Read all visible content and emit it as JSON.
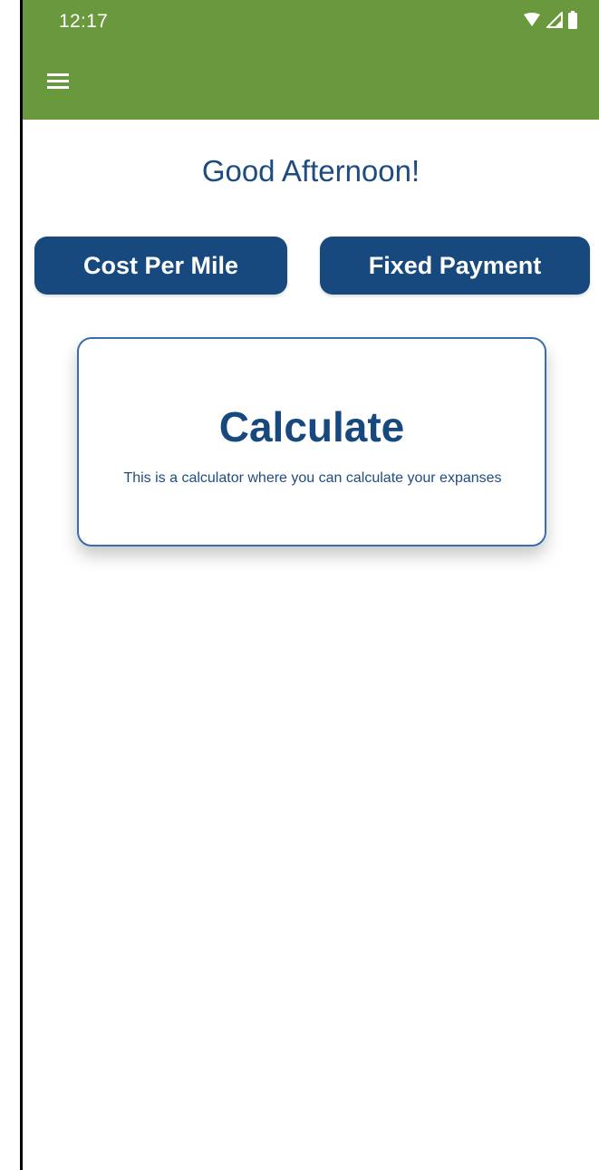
{
  "status_bar": {
    "time": "12:17",
    "icons": [
      "wifi-icon",
      "cellular-signal-icon",
      "battery-icon"
    ]
  },
  "app_bar": {
    "menu_icon": "hamburger-menu-icon",
    "color": "#6a983c"
  },
  "main": {
    "greeting": "Good Afternoon!",
    "tabs": [
      {
        "label": "Cost Per Mile"
      },
      {
        "label": "Fixed Payment"
      }
    ],
    "card": {
      "title": "Calculate",
      "description": "This is a calculator where you can calculate your expanses"
    }
  },
  "colors": {
    "primary": "#17497e",
    "accent_green": "#6a983c",
    "text_blue": "#1f4c80",
    "card_border": "#3b6ea8"
  }
}
